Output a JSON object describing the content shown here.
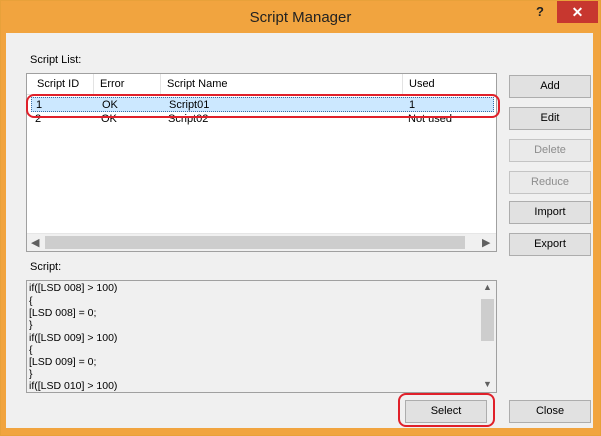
{
  "window": {
    "title": "Script Manager"
  },
  "titlebar": {
    "help_label": "?",
    "close_label": "✕"
  },
  "script_list": {
    "label": "Script List:",
    "columns": [
      "Script ID",
      "Error",
      "Script Name",
      "Used"
    ],
    "rows": [
      {
        "id": "1",
        "error": "OK",
        "name": "Script01",
        "used": "1",
        "selected": true
      },
      {
        "id": "2",
        "error": "OK",
        "name": "Script02",
        "used": "Not used",
        "selected": false
      }
    ]
  },
  "side_buttons": {
    "add": "Add",
    "edit": "Edit",
    "delete": "Delete",
    "reduce": "Reduce",
    "import": "Import",
    "export": "Export"
  },
  "script": {
    "label": "Script:",
    "lines": [
      "if([LSD 008] > 100)",
      "{",
      "[LSD 008] = 0;",
      "}",
      "if([LSD 009] > 100)",
      "{",
      "[LSD 009] = 0;",
      "}",
      "if([LSD 010] > 100)"
    ]
  },
  "footer": {
    "select": "Select",
    "close": "Close"
  },
  "icons": {
    "scroll_left": "◀",
    "scroll_right": "▶",
    "scroll_up": "▲",
    "scroll_down": "▼"
  },
  "colors": {
    "titlebar": "#f1a43f",
    "close_button": "#c7372f",
    "selection": "#cce8ff",
    "highlight": "#e0202a"
  }
}
